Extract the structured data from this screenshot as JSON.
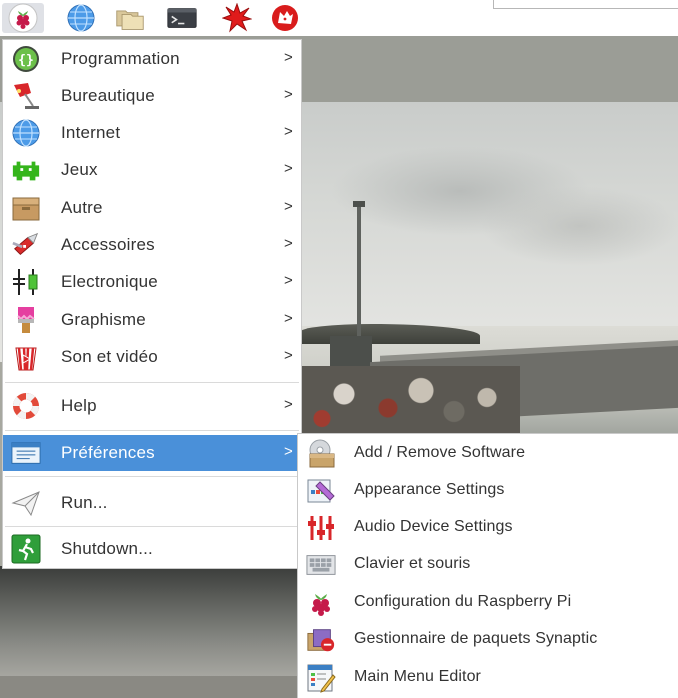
{
  "menu": {
    "items": [
      {
        "label": "Programmation",
        "icon": "code-braces-icon"
      },
      {
        "label": "Bureautique",
        "icon": "desk-lamp-icon"
      },
      {
        "label": "Internet",
        "icon": "globe-icon"
      },
      {
        "label": "Jeux",
        "icon": "space-invader-icon"
      },
      {
        "label": "Autre",
        "icon": "box-icon"
      },
      {
        "label": "Accessoires",
        "icon": "pocket-knife-icon"
      },
      {
        "label": "Electronique",
        "icon": "circuit-components-icon"
      },
      {
        "label": "Graphisme",
        "icon": "paint-brush-icon"
      },
      {
        "label": "Son et vidéo",
        "icon": "popcorn-icon"
      },
      {
        "label": "Help",
        "icon": "lifebuoy-icon"
      },
      {
        "label": "Préférences",
        "icon": "preferences-window-icon"
      },
      {
        "label": "Run...",
        "icon": "paper-plane-icon"
      },
      {
        "label": "Shutdown...",
        "icon": "exit-running-man-icon"
      }
    ],
    "arrow": ">"
  },
  "submenu": {
    "items": [
      {
        "label": "Add / Remove Software",
        "icon": "package-disc-icon"
      },
      {
        "label": "Appearance Settings",
        "icon": "appearance-palette-icon"
      },
      {
        "label": "Audio Device Settings",
        "icon": "audio-mixer-icon"
      },
      {
        "label": "Clavier et souris",
        "icon": "keyboard-icon"
      },
      {
        "label": "Configuration du Raspberry Pi",
        "icon": "raspberry-icon"
      },
      {
        "label": "Gestionnaire de paquets Synaptic",
        "icon": "synaptic-package-icon"
      },
      {
        "label": "Main Menu Editor",
        "icon": "menu-editor-icon"
      }
    ]
  },
  "colors": {
    "highlight": "#4a90d9",
    "menu_bg": "#ffffff",
    "text": "#333333"
  }
}
